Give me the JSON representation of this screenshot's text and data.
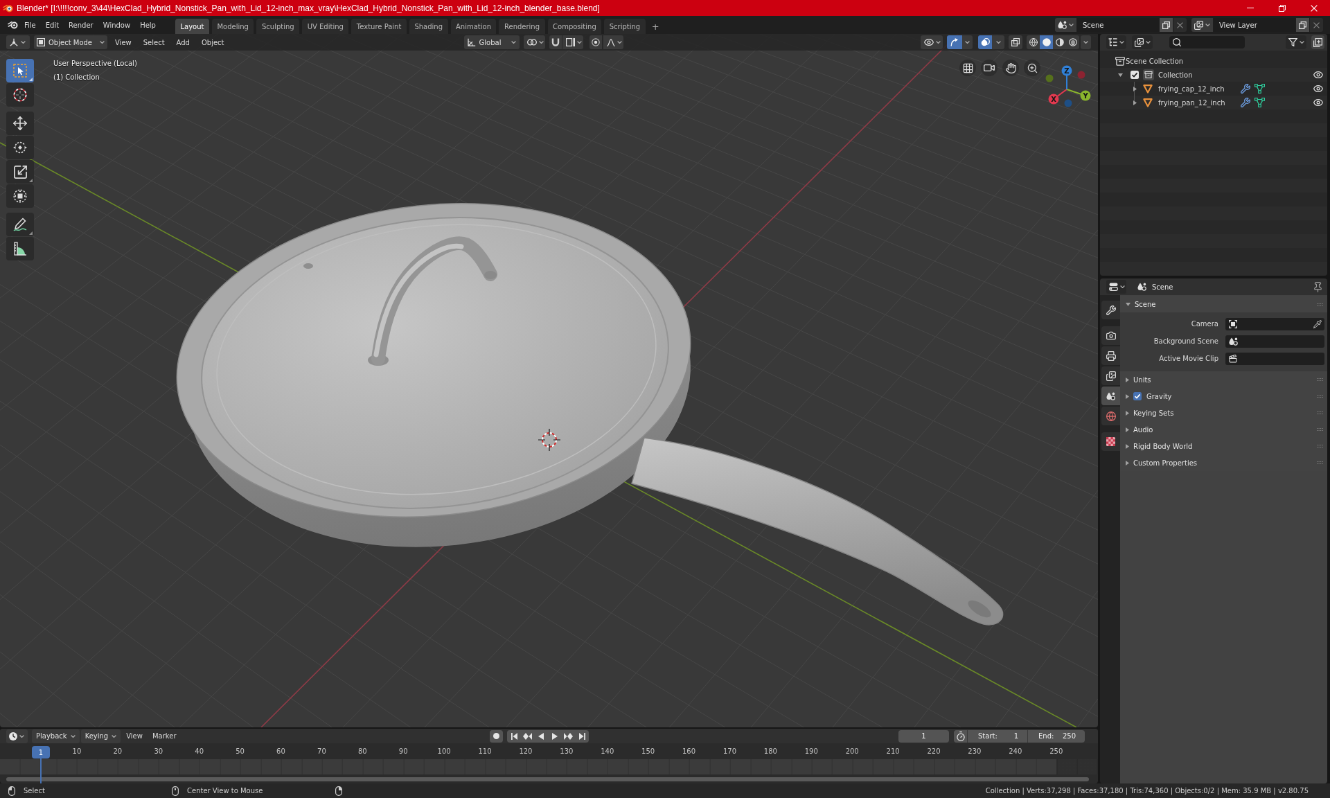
{
  "window": {
    "title": "Blender* [I:\\!!!!conv_3\\44\\HexClad_Hybrid_Nonstick_Pan_with_Lid_12-inch_max_vray\\HexClad_Hybrid_Nonstick_Pan_with_Lid_12-inch_blender_base.blend]"
  },
  "top_bar": {
    "menus": [
      "File",
      "Edit",
      "Render",
      "Window",
      "Help"
    ],
    "workspaces": [
      {
        "label": "Layout",
        "selected": true
      },
      {
        "label": "Modeling",
        "selected": false
      },
      {
        "label": "Sculpting",
        "selected": false
      },
      {
        "label": "UV Editing",
        "selected": false
      },
      {
        "label": "Texture Paint",
        "selected": false
      },
      {
        "label": "Shading",
        "selected": false
      },
      {
        "label": "Animation",
        "selected": false
      },
      {
        "label": "Rendering",
        "selected": false
      },
      {
        "label": "Compositing",
        "selected": false
      },
      {
        "label": "Scripting",
        "selected": false
      }
    ],
    "add_workspace": "+",
    "scene": "Scene",
    "view_layer": "View Layer"
  },
  "viewport": {
    "header": {
      "mode": "Object Mode",
      "menus": [
        "View",
        "Select",
        "Add",
        "Object"
      ],
      "orientation": "Global",
      "snap": false,
      "proportional_editing": false,
      "show_gizmos": true,
      "show_overlays": true,
      "xray": false,
      "shading": [
        {
          "kind": "wireframe",
          "selected": false
        },
        {
          "kind": "solid",
          "selected": true
        },
        {
          "kind": "material",
          "selected": false
        },
        {
          "kind": "rendered",
          "selected": false
        }
      ]
    },
    "toolbar": [
      {
        "tools": [
          {
            "kind": "select_box",
            "selected": true,
            "more": true
          },
          {
            "kind": "cursor",
            "selected": false,
            "more": false
          }
        ]
      },
      {
        "tools": [
          {
            "kind": "move",
            "selected": false,
            "more": false
          },
          {
            "kind": "rotate",
            "selected": false,
            "more": false
          },
          {
            "kind": "scale",
            "selected": false,
            "more": true
          },
          {
            "kind": "transform",
            "selected": false,
            "more": false
          }
        ]
      },
      {
        "tools": [
          {
            "kind": "annotate",
            "selected": false,
            "more": true
          },
          {
            "kind": "measure",
            "selected": false,
            "more": false
          }
        ]
      }
    ],
    "info": [
      "User Perspective (Local)",
      "(1) Collection"
    ],
    "gizmo_axes": [
      {
        "label": "X",
        "color": "#e2394f"
      },
      {
        "label": "Y",
        "color": "#8ab52d"
      },
      {
        "label": "Z",
        "color": "#3080d8"
      }
    ]
  },
  "outliner": {
    "tree": [
      {
        "label": "Scene Collection",
        "kind": "scene_collection",
        "selected": false,
        "children": [
          {
            "label": "Collection",
            "kind": "collection",
            "expanded": true,
            "checked": true,
            "visible": true,
            "selected": false,
            "children": [
              {
                "label": "frying_cap_12_inch",
                "kind": "mesh_object",
                "expanded": false,
                "visible": true,
                "selected": false
              },
              {
                "label": "frying_pan_12_inch",
                "kind": "mesh_object",
                "expanded": false,
                "visible": true,
                "selected": false
              }
            ]
          }
        ]
      }
    ]
  },
  "properties": {
    "context": "Scene",
    "tabs": [
      {
        "tabs": [
          {
            "kind": "tool",
            "selected": false
          }
        ]
      },
      {
        "tabs": [
          {
            "kind": "render",
            "selected": false
          },
          {
            "kind": "output",
            "selected": false
          },
          {
            "kind": "view_layer",
            "selected": false
          },
          {
            "kind": "scene",
            "selected": true
          },
          {
            "kind": "world",
            "selected": false
          }
        ]
      },
      {
        "tabs": [
          {
            "kind": "texture",
            "selected": false
          }
        ]
      }
    ],
    "panels": [
      {
        "title": "Scene",
        "expanded": true,
        "fields": [
          {
            "label": "Camera",
            "kind": "camera"
          },
          {
            "label": "Background Scene",
            "kind": "scene"
          },
          {
            "label": "Active Movie Clip",
            "kind": "movie_clip"
          }
        ]
      },
      {
        "title": "Units",
        "expanded": false
      },
      {
        "title": "Gravity",
        "expanded": false,
        "checked": true
      },
      {
        "title": "Keying Sets",
        "expanded": false
      },
      {
        "title": "Audio",
        "expanded": false
      },
      {
        "title": "Rigid Body World",
        "expanded": false
      },
      {
        "title": "Custom Properties",
        "expanded": false
      }
    ]
  },
  "timeline": {
    "menus": [
      {
        "label": "Playback",
        "dropdown": true
      },
      {
        "label": "Keying",
        "dropdown": true
      },
      {
        "label": "View",
        "dropdown": false
      },
      {
        "label": "Marker",
        "dropdown": false
      }
    ],
    "auto_keying": false,
    "current_frame": "1",
    "start": {
      "label": "Start:",
      "value": "1"
    },
    "end": {
      "label": "End:",
      "value": "250"
    },
    "current_frame_badge": "1",
    "ruler": [
      "10",
      "20",
      "30",
      "40",
      "50",
      "60",
      "70",
      "80",
      "90",
      "100",
      "110",
      "120",
      "130",
      "140",
      "150",
      "160",
      "170",
      "180",
      "190",
      "200",
      "210",
      "220",
      "230",
      "240",
      "250"
    ]
  },
  "status_bar": {
    "hints": [
      {
        "kind": "left",
        "label": "Select"
      },
      {
        "kind": "middle",
        "label": "Center View to Mouse"
      },
      {
        "kind": "right"
      }
    ],
    "stats": "Collection | Verts:37,298 | Faces:37,180 | Tris:74,360 | Objects:0/2 | Mem: 35.9 MB | v2.80.75"
  }
}
